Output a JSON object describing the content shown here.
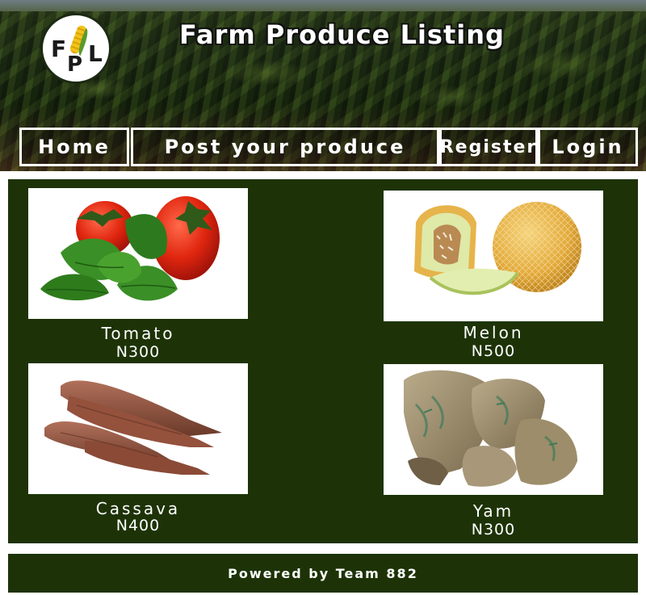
{
  "site": {
    "title": "Farm Produce Listing",
    "logo_icon": "fpl-corn-logo-icon"
  },
  "nav": {
    "items": [
      {
        "label": "Home"
      },
      {
        "label": "Post your produce"
      },
      {
        "label": "Register"
      },
      {
        "label": "Login"
      }
    ]
  },
  "products": [
    {
      "name": "Tomato",
      "price": "N300",
      "image_icon": "tomato-image"
    },
    {
      "name": "Melon",
      "price": "N500",
      "image_icon": "melon-image"
    },
    {
      "name": "Cassava",
      "price": "N400",
      "image_icon": "cassava-image"
    },
    {
      "name": "Yam",
      "price": "N300",
      "image_icon": "yam-image"
    }
  ],
  "footer": {
    "text": "Powered by Team 882"
  },
  "colors": {
    "panel_green": "#1d3307",
    "nav_border": "#ffffff",
    "text_light": "#ffffff"
  }
}
